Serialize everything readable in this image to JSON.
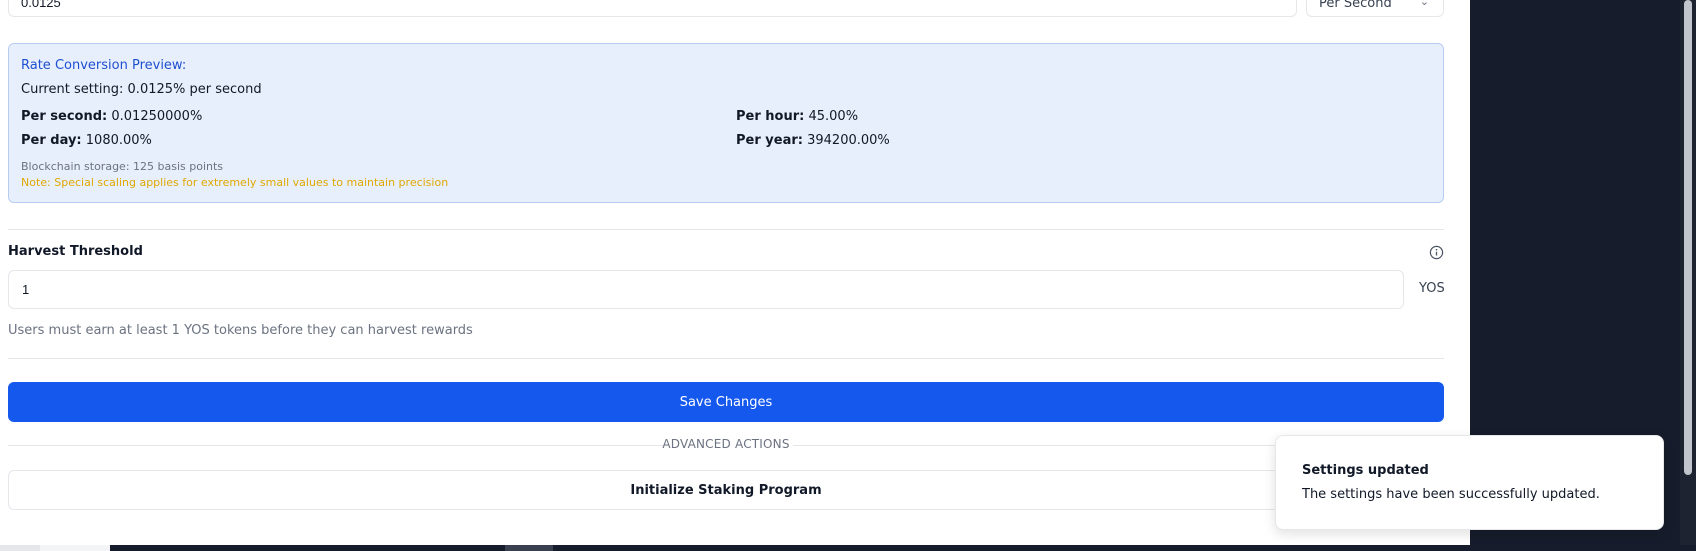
{
  "rate": {
    "value": "0.0125",
    "unit_selected": "Per Second"
  },
  "preview": {
    "title": "Rate Conversion Preview:",
    "current_setting": "Current setting: 0.0125% per second",
    "per_second_label": "Per second:",
    "per_second_value": "0.01250000%",
    "per_hour_label": "Per hour:",
    "per_hour_value": "45.00%",
    "per_day_label": "Per day:",
    "per_day_value": "1080.00%",
    "per_year_label": "Per year:",
    "per_year_value": "394200.00%",
    "storage_note": "Blockchain storage: 125 basis points",
    "scaling_note": "Note: Special scaling applies for extremely small values to maintain precision"
  },
  "harvest": {
    "label": "Harvest Threshold",
    "value": "1",
    "unit": "YOS",
    "help": "Users must earn at least 1 YOS tokens before they can harvest rewards"
  },
  "actions": {
    "save_label": "Save Changes",
    "advanced_label": "ADVANCED ACTIONS",
    "initialize_label": "Initialize Staking Program"
  },
  "toast": {
    "title": "Settings updated",
    "message": "The settings have been successfully updated."
  },
  "colors": {
    "primary": "#1558ee",
    "preview_bg": "#e8effc",
    "preview_border": "#b6cdf1",
    "title_blue": "#1e4fd1",
    "note_yellow": "#e0a800",
    "dark_bg": "#161c2b"
  },
  "icons": {
    "info": "info-circle-icon",
    "dropdown": "chevron-down-icon"
  }
}
